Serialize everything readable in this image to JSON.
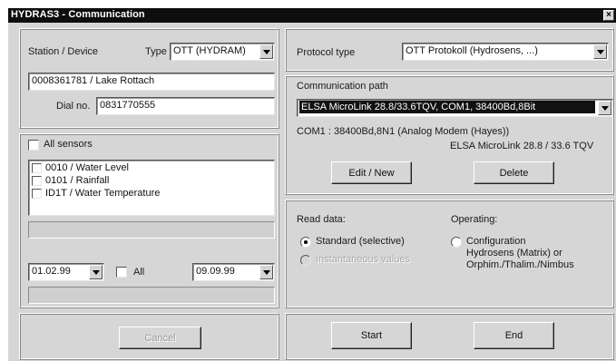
{
  "window": {
    "title": "HYDRAS3 - Communication",
    "close_glyph": "×"
  },
  "left": {
    "station_label": "Station / Device",
    "type_label": "Type",
    "type_value": "OTT (HYDRAM)",
    "station_value": "0008361781 / Lake Rottach",
    "dial_label": "Dial no.",
    "dial_value": "0831770555",
    "all_sensors_label": "All sensors",
    "sensors": [
      {
        "label": "0010 / Water Level"
      },
      {
        "label": "0101 / Rainfall"
      },
      {
        "label": "ID1T / Water Temperature"
      }
    ],
    "date_from": "01.02.99",
    "all_label": "All",
    "date_to": "09.09.99",
    "cancel_label": "Cancel"
  },
  "right": {
    "protocol_label": "Protocol type",
    "protocol_value": "OTT Protokoll (Hydrosens, ...)",
    "comm_path_label": "Communication path",
    "comm_path_value": "ELSA MicroLink 28.8/33.6TQV,  COM1,  38400Bd,8Bit",
    "com_info": "COM1 :  38400Bd,8N1  (Analog Modem (Hayes))",
    "modem_info": "ELSA MicroLink 28.8 / 33.6 TQV",
    "edit_label": "Edit / New",
    "delete_label": "Delete",
    "read_data_label": "Read data:",
    "operating_label": "Operating:",
    "standard_label": "Standard (selective)",
    "instantaneous_label": "Instantaneous values",
    "config_line1": "Configuration",
    "config_line2": "Hydrosens (Matrix)  or",
    "config_line3": "Orphim./Thalim./Nimbus",
    "start_label": "Start",
    "end_label": "End"
  }
}
